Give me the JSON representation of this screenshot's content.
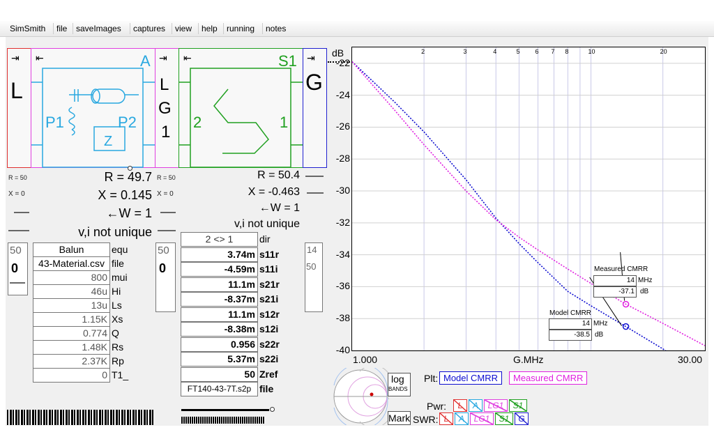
{
  "menu": [
    "SimSmith",
    "file",
    "saveImages",
    "captures",
    "view",
    "help",
    "running",
    "notes"
  ],
  "help_mark": "?",
  "blocks": {
    "L": {
      "label": "L",
      "arrow": "⇥"
    },
    "A": {
      "label": "A",
      "P1": "P1",
      "P2": "P2",
      "Z": "Z",
      "arrow": "⇤"
    },
    "LG1": {
      "l": "L",
      "g": "G",
      "one": "1",
      "arrow": "⇥"
    },
    "S1": {
      "label": "S1",
      "two": "2",
      "one": "1",
      "arrow": "⇤"
    },
    "G": {
      "label": "G",
      "arrow": "⇥"
    }
  },
  "left_side": {
    "r": "R = 50",
    "x": "X = 0"
  },
  "mid_side": {
    "r": "R = 50",
    "x": "X = 0"
  },
  "left_readout": {
    "r": "R = 49.7",
    "x": "X = 0.145",
    "w": "←W = 1",
    "vi": "v,i not unique"
  },
  "right_readout": {
    "r": "R = 50.4",
    "x": "X = -0.463",
    "w": "←W = 1",
    "vi": "v,i not unique"
  },
  "load": {
    "v1": "50",
    "v2": "0"
  },
  "mid_load": {
    "v1": "50",
    "v2": "0"
  },
  "gen": {
    "v1": "14",
    "v2": "50"
  },
  "balun_fields": [
    {
      "value": "Balun",
      "label": "equ"
    },
    {
      "value": "43-Material.csv",
      "label": "file"
    },
    {
      "value": "800",
      "label": "mui"
    },
    {
      "value": "46u",
      "label": "Hi"
    },
    {
      "value": "13u",
      "label": "Ls"
    },
    {
      "value": "1.15K",
      "label": "Xs"
    },
    {
      "value": "0.774",
      "label": "Q"
    },
    {
      "value": "1.48K",
      "label": "Rs"
    },
    {
      "value": "2.37K",
      "label": "Rp"
    },
    {
      "value": "0",
      "label": "T1_"
    }
  ],
  "s_fields": [
    {
      "value": "2 <> 1",
      "label": "dir"
    },
    {
      "value": "3.74m",
      "label": "s11r"
    },
    {
      "value": "-4.59m",
      "label": "s11i"
    },
    {
      "value": "11.1m",
      "label": "s21r"
    },
    {
      "value": "-8.37m",
      "label": "s21i"
    },
    {
      "value": "11.1m",
      "label": "s12r"
    },
    {
      "value": "-8.38m",
      "label": "s12i"
    },
    {
      "value": "0.956",
      "label": "s22r"
    },
    {
      "value": "5.37m",
      "label": "s22i"
    },
    {
      "value": "50",
      "label": "Zref"
    },
    {
      "value": "FT140-43-7T.s2p",
      "label": "file"
    }
  ],
  "chart_data": {
    "type": "line",
    "ylabel": "dB",
    "xlabel": "G.MHz",
    "x_scale": "log",
    "xlim": [
      1.0,
      30.0
    ],
    "ylim": [
      -40,
      -21
    ],
    "x_start_label": "1.000",
    "x_end_label": "30.00",
    "x_top_ticks": [
      "2",
      "3",
      "4",
      "5",
      "6",
      "7",
      "8",
      "10",
      "20"
    ],
    "x_top_values": [
      2,
      3,
      4,
      5,
      6,
      7,
      8,
      10,
      20
    ],
    "y_ticks": [
      -22,
      -24,
      -26,
      -28,
      -30,
      -32,
      -34,
      -36,
      -38,
      -40
    ],
    "grid": true,
    "series": [
      {
        "name": "Model CMRR",
        "color": "#0b0bd0",
        "x": [
          1,
          1.5,
          2,
          3,
          4,
          5,
          6,
          8,
          10,
          14,
          20,
          30
        ],
        "y": [
          -21.9,
          -24.4,
          -26.3,
          -29.3,
          -31.7,
          -33.3,
          -34.5,
          -36.3,
          -37.2,
          -38.5,
          -39.9,
          -41.7
        ]
      },
      {
        "name": "Measured CMRR",
        "color": "#e020e0",
        "x": [
          1,
          1.5,
          2,
          3,
          4,
          5,
          6,
          8,
          10,
          14,
          20,
          30
        ],
        "y": [
          -21.9,
          -24.9,
          -27.1,
          -30.0,
          -31.8,
          -32.9,
          -33.7,
          -34.9,
          -35.8,
          -37.1,
          -38.3,
          -39.7
        ]
      }
    ],
    "markers": [
      {
        "title": "Measured CMRR",
        "freq": "14",
        "freq_unit": "MHz",
        "val": "-37.1",
        "val_unit": "dB",
        "color": "#e020e0"
      },
      {
        "title": "Model CMRR",
        "freq": "14",
        "freq_unit": "MHz",
        "val": "-38.5",
        "val_unit": "dB",
        "color": "#0b0bd0"
      }
    ]
  },
  "controls": {
    "log": "log",
    "bands": "BANDS",
    "mark": "Mark",
    "plt": "Plt:",
    "pwr": "Pwr:",
    "swr": "SWR:",
    "pwr_btns": [
      "L",
      "A",
      "LG1",
      "S1"
    ],
    "swr_btns": [
      "L",
      "A",
      "LG1",
      "S1",
      "G"
    ]
  }
}
